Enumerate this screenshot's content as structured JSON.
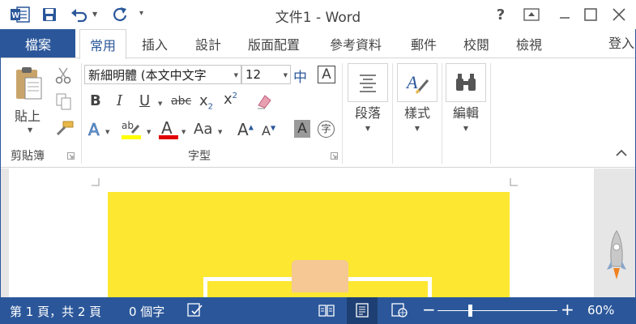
{
  "window": {
    "title": "文件1 - Word",
    "help": "?",
    "accent": "#2b579a"
  },
  "qat": {
    "icons": [
      "word-icon",
      "save-icon",
      "undo-icon",
      "redo-icon",
      "customize-icon"
    ]
  },
  "tabs": {
    "file": "檔案",
    "items": [
      "常用",
      "插入",
      "設計",
      "版面配置",
      "參考資料",
      "郵件",
      "校閱",
      "檢視"
    ],
    "active": "常用",
    "login": "登入"
  },
  "ribbon": {
    "clipboard": {
      "label": "剪貼簿",
      "paste": "貼上"
    },
    "font": {
      "label": "字型",
      "name": "新細明體 (本文中文字",
      "size": "12",
      "bold": "B",
      "italic": "I",
      "underline": "U",
      "strike": "abc",
      "subscript": "x",
      "subscript_mark": "2",
      "superscript": "x",
      "superscript_mark": "2",
      "highlight_text": "ab",
      "font_color": "A",
      "text_effects": "A",
      "change_case": "Aa",
      "grow": "A",
      "shrink": "A",
      "shading": "A",
      "enclose": "字",
      "phonetic": "中",
      "border_char": "A",
      "highlight_color": "#ffff00",
      "font_color_value": "#e00000"
    },
    "paragraph": {
      "label": "段落"
    },
    "styles": {
      "label": "樣式"
    },
    "editing": {
      "label": "編輯"
    }
  },
  "document": {
    "image_colors": {
      "background": "#fde731",
      "hand": "#f5c894"
    }
  },
  "status": {
    "page": "第 1 頁，共 2 頁",
    "words": "0 個字",
    "zoom_minus": "−",
    "zoom_plus": "+",
    "zoom": "60%",
    "zoom_level": 0.27
  }
}
